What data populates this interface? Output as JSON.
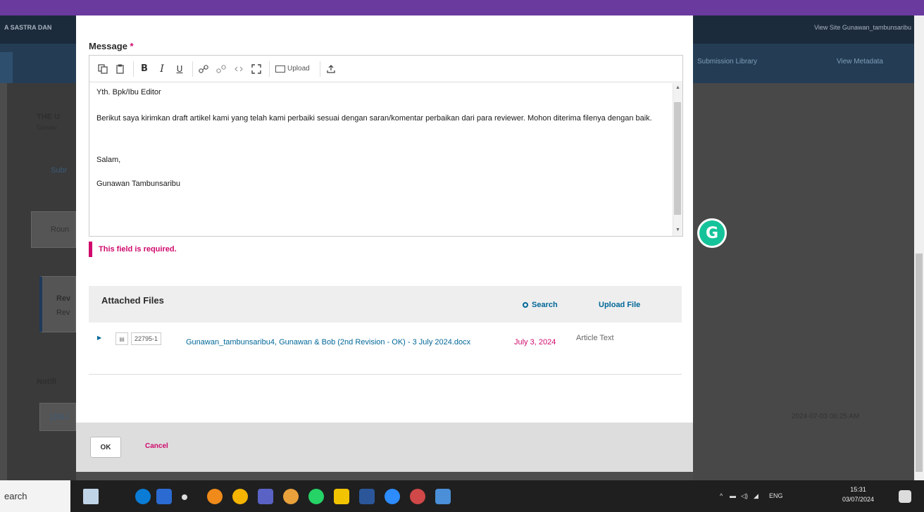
{
  "background": {
    "header_left": "A SASTRA DAN",
    "header_right": "View Site   Gunawan_tambunsaribu",
    "nav_links": [
      "Submission Library",
      "View Metadata"
    ],
    "sidebar_text_1": "THE U",
    "sidebar_text_2": "Gunaw",
    "sidebar_tab": "Subr",
    "panel_label": "Roun",
    "box_label_1": "Rev",
    "box_label_2": "Rev",
    "notif_label": "Notifi",
    "notif_link": "[JSLI",
    "notif_date": "2024-07-03 06:25 AM"
  },
  "modal": {
    "message_label": "Message",
    "required_mark": "*",
    "toolbar": {
      "upload_label": "Upload"
    },
    "body_lines": [
      "Yth. Bpk/Ibu Editor",
      "",
      "Berikut saya kirimkan draft artikel kami yang telah kami perbaiki sesuai dengan saran/komentar perbaikan dari para reviewer. Mohon diterima filenya dengan baik.",
      "",
      "",
      "Salam,",
      "",
      "Gunawan Tambunsaribu"
    ],
    "error_text": "This field is required.",
    "attached_files": {
      "title": "Attached Files",
      "search_label": "Search",
      "upload_label": "Upload File",
      "files": [
        {
          "id": "22795-1",
          "name": "Gunawan_tambunsaribu4, Gunawan & Bob (2nd Revision - OK) - 3 July 2024.docx",
          "date": "July 3, 2024",
          "type": "Article Text"
        }
      ]
    },
    "ok_label": "OK",
    "cancel_label": "Cancel"
  },
  "grammarly_letter": "G",
  "taskbar": {
    "search_text": "earch",
    "tray_lang": "ENG",
    "time": "15:31",
    "date": "03/07/2024"
  }
}
